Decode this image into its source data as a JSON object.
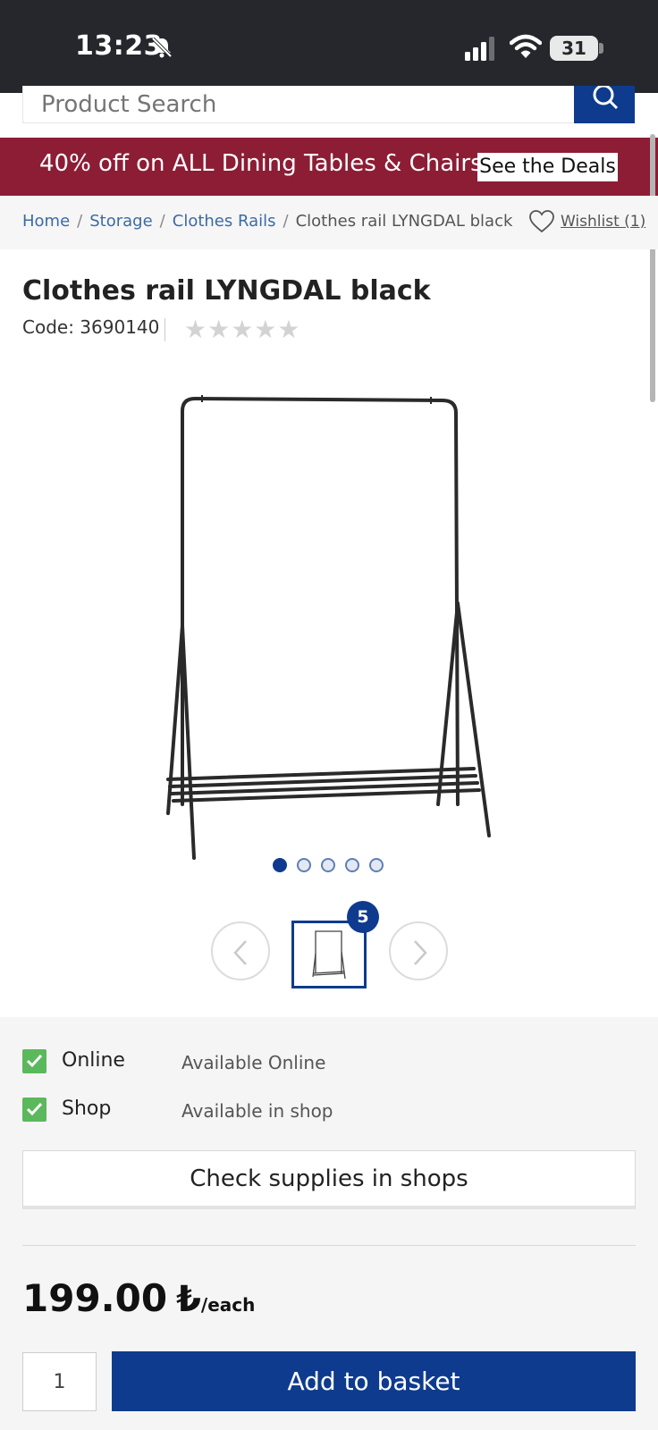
{
  "status_bar": {
    "time": "13:23",
    "battery": "31"
  },
  "search": {
    "placeholder": "Product Search"
  },
  "promo": {
    "text": "40% off on ALL Dining Tables & Chairs",
    "cta": "See the Deals"
  },
  "breadcrumb": {
    "items": [
      "Home",
      "Storage",
      "Clothes Rails"
    ],
    "current": "Clothes rail LYNGDAL black",
    "separator": "/"
  },
  "wishlist": {
    "label": "Wishlist (1)"
  },
  "product": {
    "title": "Clothes rail LYNGDAL black",
    "code": "Code: 3690140",
    "rating_stars": "★★★★★",
    "image_count": "5",
    "active_image": 1
  },
  "availability": [
    {
      "channel": "Online",
      "status": "Available Online"
    },
    {
      "channel": "Shop",
      "status": "Available in shop"
    }
  ],
  "check_supplies": "Check supplies in shops",
  "price": {
    "amount": "199.00",
    "currency": "₺",
    "unit": "/each"
  },
  "purchase": {
    "quantity": "1",
    "add_label": "Add to basket"
  },
  "colors": {
    "brand_blue": "#0e3b8e",
    "promo_red": "#8c1d35",
    "check_green": "#5cb85c"
  }
}
